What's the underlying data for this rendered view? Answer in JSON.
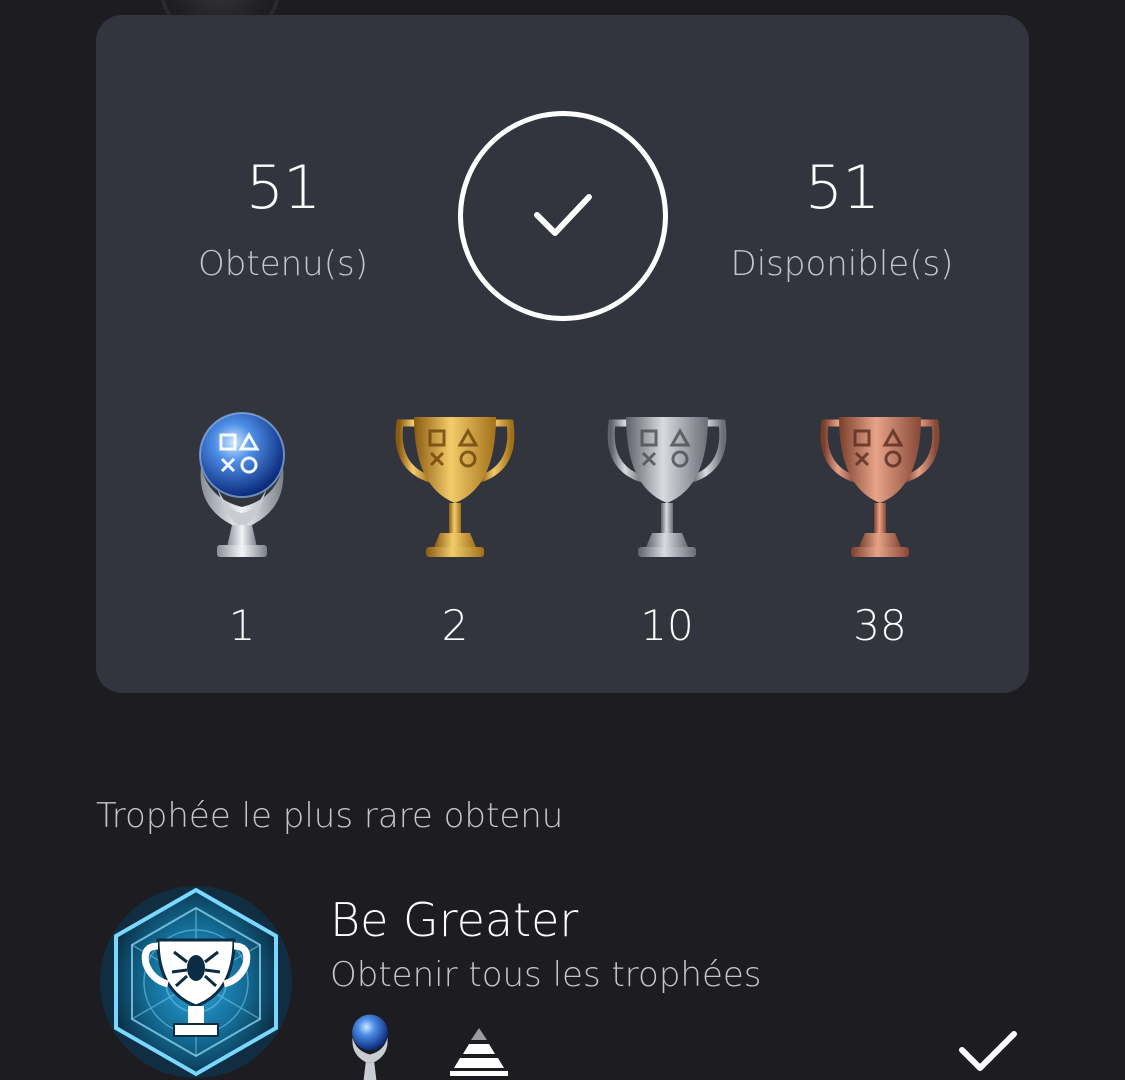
{
  "summary": {
    "earned_value": "51",
    "earned_label": "Obtenu(s)",
    "available_value": "51",
    "available_label": "Disponible(s)",
    "status_icon": "checkmark-icon"
  },
  "trophy_counts": [
    {
      "grade": "platinum",
      "count": "1"
    },
    {
      "grade": "gold",
      "count": "2"
    },
    {
      "grade": "silver",
      "count": "10"
    },
    {
      "grade": "bronze",
      "count": "38"
    }
  ],
  "rarest": {
    "section_title": "Trophée le plus rare obtenu",
    "name": "Be Greater",
    "description": "Obtenir tous les trophées",
    "grade_icon": "platinum-trophy-icon",
    "rarity_icon": "rarity-pyramid-icon",
    "earned_icon": "checkmark-icon"
  },
  "colors": {
    "background": "#1d1d21",
    "card": "#32353d",
    "text": "#ffffff",
    "muted_text": "#c4c6cc"
  }
}
